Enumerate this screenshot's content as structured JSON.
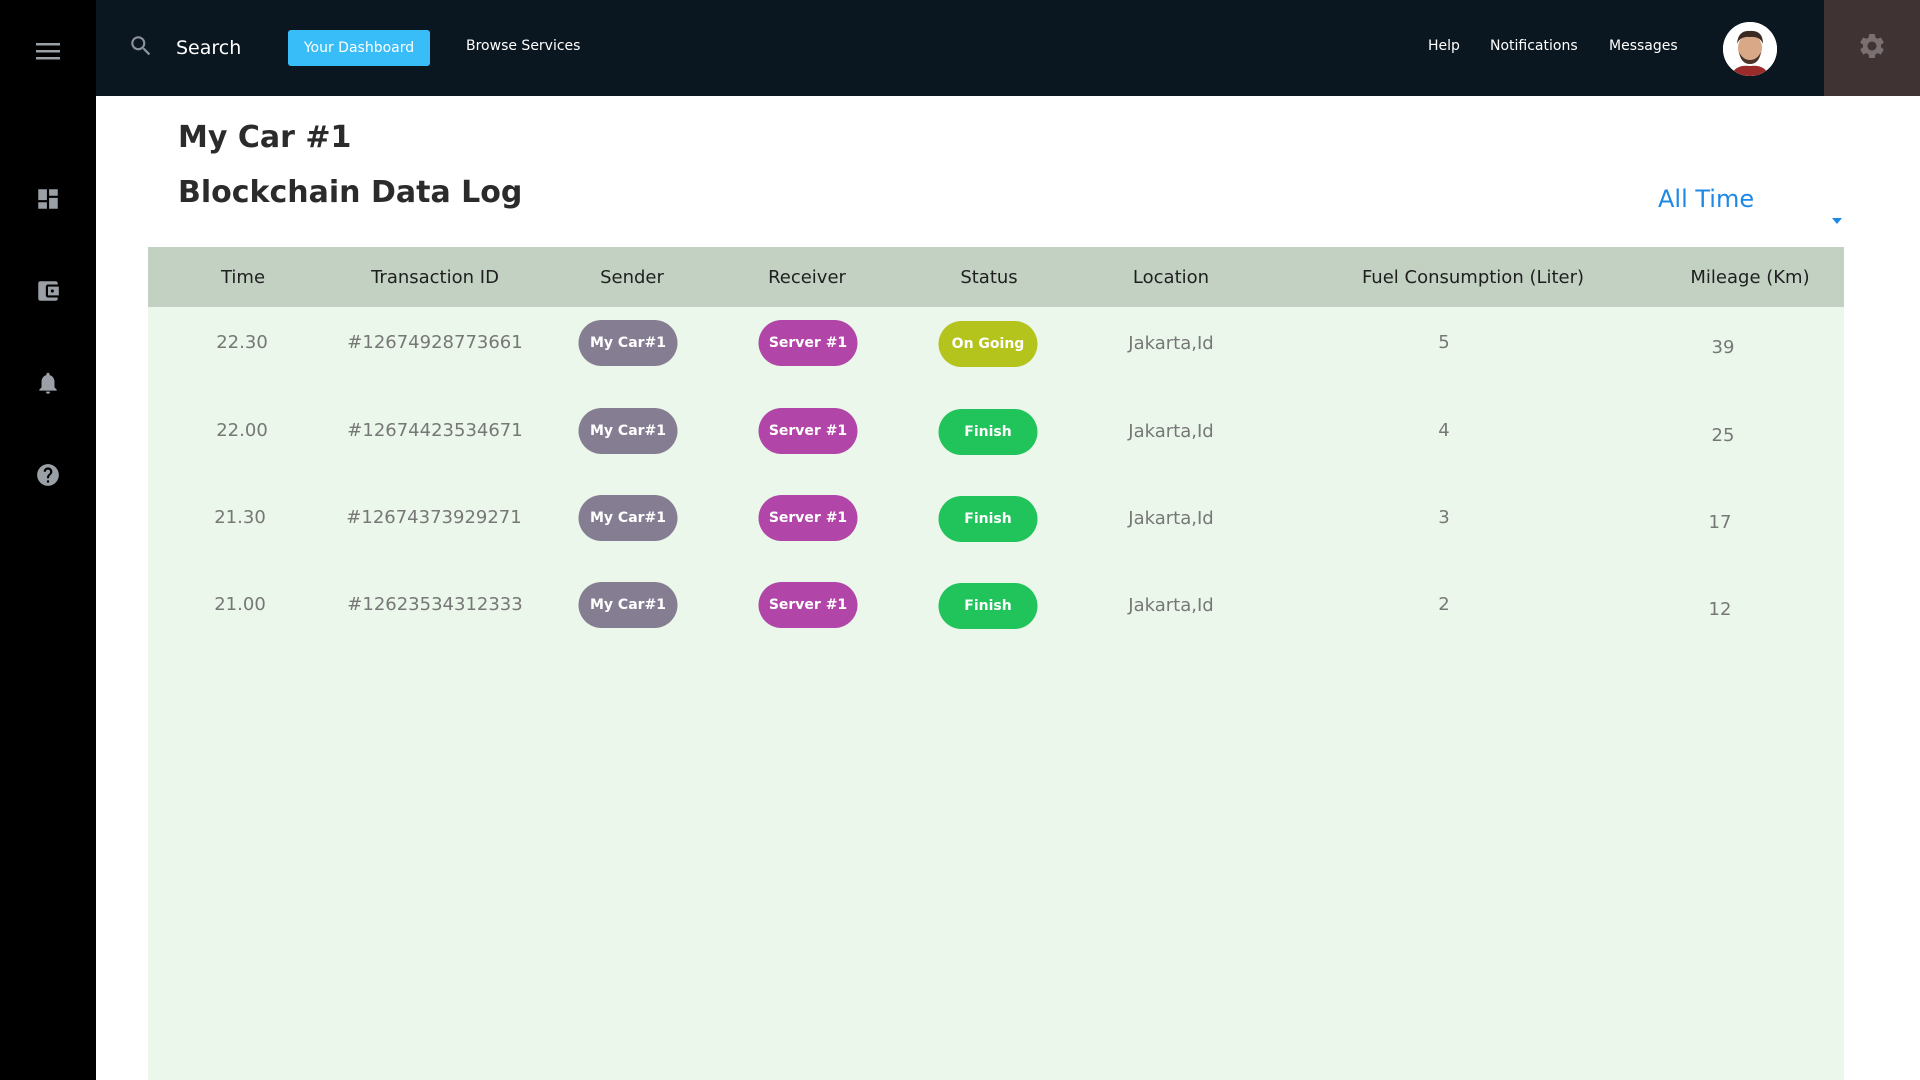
{
  "topbar": {
    "search_label": "Search",
    "dashboard_label": "Your Dashboard",
    "browse_label": "Browse Services",
    "help_label": "Help",
    "notifications_label": "Notifications",
    "messages_label": "Messages"
  },
  "page": {
    "title": "My Car #1",
    "subtitle": "Blockchain Data Log",
    "filter_label": "All Time"
  },
  "table": {
    "headers": [
      "Time",
      "Transaction ID",
      "Sender",
      "Receiver",
      "Status",
      "Location",
      "Fuel Consumption (Liter)",
      "Mileage (Km)"
    ],
    "rows": [
      {
        "time": "22.30",
        "tx": "#12674928773661",
        "sender": "My Car#1",
        "receiver": "Server #1",
        "status": "On Going",
        "location": "Jakarta,Id",
        "fuel": "5",
        "mileage": "39"
      },
      {
        "time": "22.00",
        "tx": "#12674423534671",
        "sender": "My Car#1",
        "receiver": "Server #1",
        "status": "Finish",
        "location": "Jakarta,Id",
        "fuel": "4",
        "mileage": "25"
      },
      {
        "time": "21.30",
        "tx": "#12674373929271",
        "sender": "My Car#1",
        "receiver": "Server #1",
        "status": "Finish",
        "location": "Jakarta,Id",
        "fuel": "3",
        "mileage": "17"
      },
      {
        "time": "21.00",
        "tx": "#12623534312333",
        "sender": "My Car#1",
        "receiver": "Server #1",
        "status": "Finish",
        "location": "Jakarta,Id",
        "fuel": "2",
        "mileage": "12"
      }
    ]
  },
  "colors": {
    "accent": "#38bdf8",
    "filter": "#1e88e5",
    "sender_pill": "#857d92",
    "receiver_pill": "#b146a8",
    "status_ongoing": "#b4c41c",
    "status_finish": "#21c35b"
  },
  "icons": {
    "sidebar": [
      "menu-icon",
      "dashboard-icon",
      "wallet-icon",
      "bell-icon",
      "help-icon"
    ],
    "topbar": [
      "search-icon",
      "gear-icon"
    ]
  }
}
